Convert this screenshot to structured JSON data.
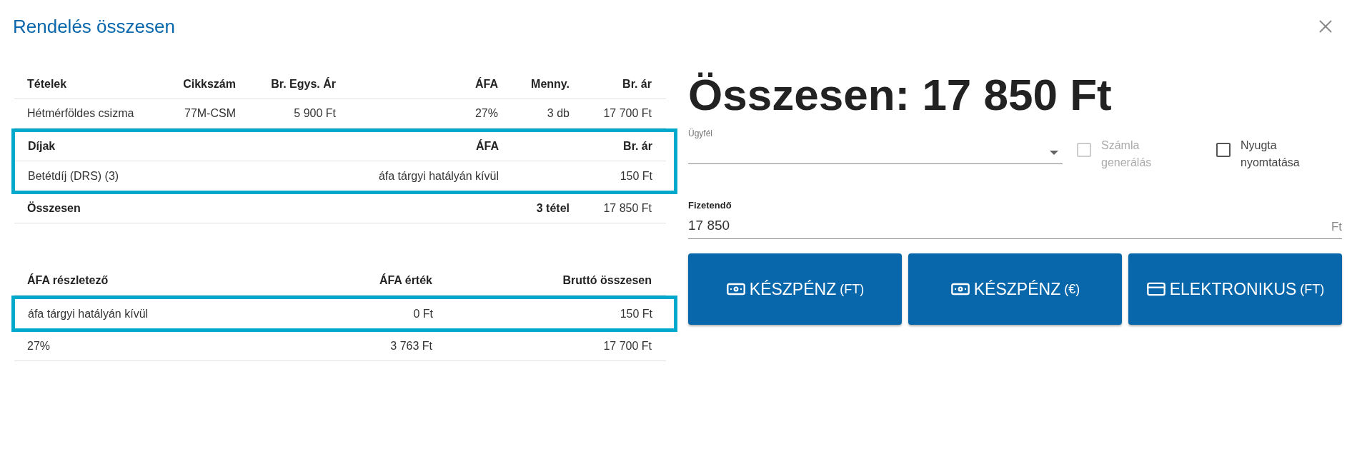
{
  "title": "Rendelés összesen",
  "items_table": {
    "columns": [
      "Tételek",
      "Cikkszám",
      "Br. Egys. Ár",
      "ÁFA",
      "Menny.",
      "Br. ár"
    ],
    "rows": [
      {
        "name": "Hétmérföldes csizma",
        "sku": "77M-CSM",
        "unit_price": "5 900 Ft",
        "vat": "27%",
        "qty": "3 db",
        "price": "17 700 Ft"
      }
    ]
  },
  "fees": {
    "highlighted": true,
    "columns": [
      "Díjak",
      "ÁFA",
      "Br. ár"
    ],
    "rows": [
      {
        "name": "Betétdíj (DRS) (3)",
        "vat": "áfa tárgyi hatályán kívül",
        "price": "150 Ft"
      }
    ]
  },
  "total_row": {
    "label": "Összesen",
    "count": "3 tétel",
    "price": "17 850 Ft"
  },
  "vat_table": {
    "columns": [
      "ÁFA részletező",
      "ÁFA érték",
      "Bruttó összesen"
    ],
    "rows": [
      {
        "name": "áfa tárgyi hatályán kívül",
        "vat_value": "0 Ft",
        "gross": "150 Ft",
        "highlighted": true
      },
      {
        "name": "27%",
        "vat_value": "3 763 Ft",
        "gross": "17 700 Ft",
        "highlighted": false
      }
    ]
  },
  "grand_total": "Összesen: 17 850 Ft",
  "customer": {
    "label": "Ügyfél"
  },
  "checkboxes": [
    {
      "label": "Számla generálás",
      "checked": false,
      "disabled": true
    },
    {
      "label": "Nyugta nyomtatása",
      "checked": false,
      "disabled": false
    }
  ],
  "payable": {
    "label": "Fizetendő",
    "value": "17 850",
    "unit": "Ft"
  },
  "buttons": [
    {
      "kind": "cash",
      "label": "KÉSZPÉNZ",
      "suffix": "(FT)"
    },
    {
      "kind": "cash",
      "label": "KÉSZPÉNZ",
      "suffix": "(€)"
    },
    {
      "kind": "card",
      "label": "ELEKTRONIKUS",
      "suffix": "(FT)"
    }
  ]
}
